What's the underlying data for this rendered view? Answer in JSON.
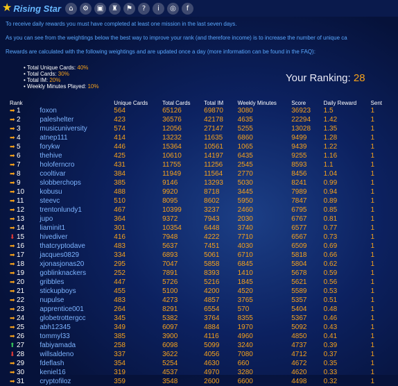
{
  "brand": {
    "star_icon": "star-icon",
    "name": "Rising Star"
  },
  "nav_icons": [
    "home-icon",
    "settings-icon",
    "cards-icon",
    "trophy-icon",
    "leaderboard-icon",
    "help-icon",
    "info-icon",
    "discord-icon",
    "facebook-icon"
  ],
  "nav_glyphs": [
    "⌂",
    "⚙",
    "▣",
    "♜",
    "⚑",
    "?",
    "i",
    "◎",
    "f"
  ],
  "intro": {
    "line1": "To receive daily rewards you must have completed at least one mission in the last seven days.",
    "line2": "As you can see from the weightings below the best way to improve your rank (and therefore income) is to increase the number of unique ca",
    "line3": "Rewards are calculated with the following weightings and are updated once a day (more information can be found in the FAQ):"
  },
  "weights": [
    {
      "label": "Total Unique Cards: ",
      "value": "40%"
    },
    {
      "label": "Total Cards: ",
      "value": "30%"
    },
    {
      "label": "Total IM: ",
      "value": "20%"
    },
    {
      "label": "Weekly Minutes Played: ",
      "value": "10%"
    }
  ],
  "ranking": {
    "label": "Your Ranking: ",
    "value": "28"
  },
  "table": {
    "headers": [
      "Rank",
      "Unique Cards",
      "Total Cards",
      "Total IM",
      "Weekly Minutes",
      "Score",
      "Daily Reward",
      "Sent"
    ],
    "rows": [
      {
        "trend": "same",
        "rank": "1",
        "user": "foxon",
        "unique": "564",
        "total": "65126",
        "im": "69870",
        "minutes": "3080",
        "score": "36923",
        "reward": "1.5",
        "sent": "1"
      },
      {
        "trend": "same",
        "rank": "2",
        "user": "paleshelter",
        "unique": "423",
        "total": "36576",
        "im": "42178",
        "minutes": "4635",
        "score": "22294",
        "reward": "1.42",
        "sent": "1"
      },
      {
        "trend": "same",
        "rank": "3",
        "user": "musicuniversity",
        "unique": "574",
        "total": "12056",
        "im": "27147",
        "minutes": "5255",
        "score": "13028",
        "reward": "1.35",
        "sent": "1"
      },
      {
        "trend": "same",
        "rank": "4",
        "user": "atnep111",
        "unique": "414",
        "total": "13232",
        "im": "11635",
        "minutes": "6860",
        "score": "9499",
        "reward": "1.28",
        "sent": "1"
      },
      {
        "trend": "same",
        "rank": "5",
        "user": "forykw",
        "unique": "446",
        "total": "15364",
        "im": "10561",
        "minutes": "1065",
        "score": "9439",
        "reward": "1.22",
        "sent": "1"
      },
      {
        "trend": "same",
        "rank": "6",
        "user": "thehive",
        "unique": "425",
        "total": "10610",
        "im": "14197",
        "minutes": "6435",
        "score": "9255",
        "reward": "1.16",
        "sent": "1"
      },
      {
        "trend": "same",
        "rank": "7",
        "user": "holoferncro",
        "unique": "431",
        "total": "11755",
        "im": "11256",
        "minutes": "2545",
        "score": "8593",
        "reward": "1.1",
        "sent": "1"
      },
      {
        "trend": "same",
        "rank": "8",
        "user": "cooltivar",
        "unique": "384",
        "total": "11949",
        "im": "11564",
        "minutes": "2770",
        "score": "8456",
        "reward": "1.04",
        "sent": "1"
      },
      {
        "trend": "same",
        "rank": "9",
        "user": "slobberchops",
        "unique": "385",
        "total": "9146",
        "im": "13293",
        "minutes": "5030",
        "score": "8241",
        "reward": "0.99",
        "sent": "1"
      },
      {
        "trend": "same",
        "rank": "10",
        "user": "kobusu",
        "unique": "488",
        "total": "9920",
        "im": "8718",
        "minutes": "3445",
        "score": "7989",
        "reward": "0.94",
        "sent": "1"
      },
      {
        "trend": "same",
        "rank": "11",
        "user": "steevc",
        "unique": "510",
        "total": "8095",
        "im": "8602",
        "minutes": "5950",
        "score": "7847",
        "reward": "0.89",
        "sent": "1"
      },
      {
        "trend": "same",
        "rank": "12",
        "user": "trentonlundy1",
        "unique": "467",
        "total": "10399",
        "im": "3237",
        "minutes": "2460",
        "score": "6795",
        "reward": "0.85",
        "sent": "1"
      },
      {
        "trend": "same",
        "rank": "13",
        "user": "jupo",
        "unique": "364",
        "total": "9372",
        "im": "7943",
        "minutes": "2030",
        "score": "6767",
        "reward": "0.81",
        "sent": "1"
      },
      {
        "trend": "same",
        "rank": "14",
        "user": "liaminit1",
        "unique": "301",
        "total": "10354",
        "im": "6448",
        "minutes": "3740",
        "score": "6577",
        "reward": "0.77",
        "sent": "1"
      },
      {
        "trend": "down",
        "rank": "15",
        "user": "hivediver",
        "unique": "416",
        "total": "7948",
        "im": "4222",
        "minutes": "7710",
        "score": "6567",
        "reward": "0.73",
        "sent": "1"
      },
      {
        "trend": "same",
        "rank": "16",
        "user": "thatcryptodave",
        "unique": "483",
        "total": "5637",
        "im": "7451",
        "minutes": "4030",
        "score": "6509",
        "reward": "0.69",
        "sent": "1"
      },
      {
        "trend": "same",
        "rank": "17",
        "user": "jacques0829",
        "unique": "334",
        "total": "6893",
        "im": "5061",
        "minutes": "6710",
        "score": "5818",
        "reward": "0.66",
        "sent": "1"
      },
      {
        "trend": "same",
        "rank": "18",
        "user": "xjonasjonas20",
        "unique": "295",
        "total": "7047",
        "im": "5858",
        "minutes": "6845",
        "score": "5804",
        "reward": "0.62",
        "sent": "1"
      },
      {
        "trend": "same",
        "rank": "19",
        "user": "goblinknackers",
        "unique": "252",
        "total": "7891",
        "im": "8393",
        "minutes": "1410",
        "score": "5678",
        "reward": "0.59",
        "sent": "1"
      },
      {
        "trend": "same",
        "rank": "20",
        "user": "gribbles",
        "unique": "447",
        "total": "5726",
        "im": "5216",
        "minutes": "1845",
        "score": "5621",
        "reward": "0.56",
        "sent": "1"
      },
      {
        "trend": "same",
        "rank": "21",
        "user": "stickupboys",
        "unique": "455",
        "total": "5100",
        "im": "4200",
        "minutes": "4520",
        "score": "5589",
        "reward": "0.53",
        "sent": "1"
      },
      {
        "trend": "same",
        "rank": "22",
        "user": "nupulse",
        "unique": "483",
        "total": "4273",
        "im": "4857",
        "minutes": "3765",
        "score": "5357",
        "reward": "0.51",
        "sent": "1"
      },
      {
        "trend": "same",
        "rank": "23",
        "user": "apprentice001",
        "unique": "264",
        "total": "8291",
        "im": "6554",
        "minutes": "570",
        "score": "5404",
        "reward": "0.48",
        "sent": "1"
      },
      {
        "trend": "same",
        "rank": "24",
        "user": "globetrottergcc",
        "unique": "345",
        "total": "5382",
        "im": "3764",
        "minutes": "8355",
        "score": "5367",
        "reward": "0.46",
        "sent": "1"
      },
      {
        "trend": "same",
        "rank": "25",
        "user": "abh12345",
        "unique": "349",
        "total": "6097",
        "im": "4884",
        "minutes": "1970",
        "score": "5092",
        "reward": "0.43",
        "sent": "1"
      },
      {
        "trend": "same",
        "rank": "26",
        "user": "tommyl33",
        "unique": "385",
        "total": "3900",
        "im": "4116",
        "minutes": "4960",
        "score": "4850",
        "reward": "0.41",
        "sent": "1"
      },
      {
        "trend": "up",
        "rank": "27",
        "user": "fabiyamada",
        "unique": "258",
        "total": "6098",
        "im": "5099",
        "minutes": "3240",
        "score": "4737",
        "reward": "0.39",
        "sent": "1"
      },
      {
        "trend": "down",
        "rank": "28",
        "user": "willsaldeno",
        "unique": "337",
        "total": "3622",
        "im": "4056",
        "minutes": "7080",
        "score": "4712",
        "reward": "0.37",
        "sent": "1"
      },
      {
        "trend": "same",
        "rank": "29",
        "user": "fdeflash",
        "unique": "354",
        "total": "5254",
        "im": "4630",
        "minutes": "660",
        "score": "4672",
        "reward": "0.35",
        "sent": "1"
      },
      {
        "trend": "same",
        "rank": "30",
        "user": "keniel16",
        "unique": "319",
        "total": "4537",
        "im": "4970",
        "minutes": "3280",
        "score": "4620",
        "reward": "0.33",
        "sent": "1"
      },
      {
        "trend": "same",
        "rank": "31",
        "user": "cryptofiloz",
        "unique": "359",
        "total": "3548",
        "im": "2600",
        "minutes": "6600",
        "score": "4498",
        "reward": "0.32",
        "sent": "1"
      }
    ]
  },
  "colors": {
    "accent": "#f7a21b",
    "username": "#7db4ff",
    "link": "#5aa8ff",
    "up": "#34c759",
    "down": "#e53935"
  }
}
